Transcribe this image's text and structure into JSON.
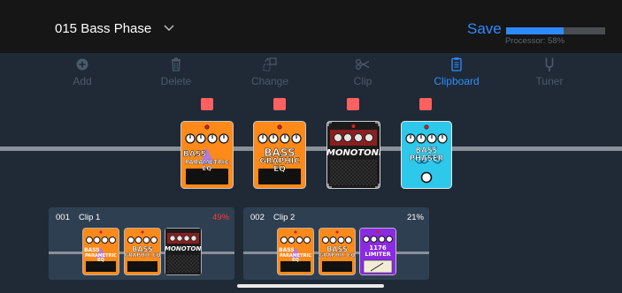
{
  "header": {
    "preset_name": "015 Bass Phase",
    "save_label": "Save",
    "processor_label": "Processor: 58%",
    "processor_fraction": 0.58
  },
  "toolbar": {
    "items": [
      {
        "label": "Add",
        "icon": "plus-circle-icon",
        "active": false
      },
      {
        "label": "Delete",
        "icon": "trash-icon",
        "active": false
      },
      {
        "label": "Change",
        "icon": "change-icon",
        "active": false
      },
      {
        "label": "Clip",
        "icon": "scissors-icon",
        "active": false
      },
      {
        "label": "Clipboard",
        "icon": "clipboard-icon",
        "active": true
      },
      {
        "label": "Tuner",
        "icon": "tuner-fork-icon",
        "active": false
      }
    ]
  },
  "chain": {
    "pedals": [
      {
        "line1": "BASS",
        "line2": "PARAMETRIC EQ",
        "style": "orange-peak"
      },
      {
        "line1": "BASS",
        "line2": "GRAPHIC EQ",
        "style": "orange-graphic"
      },
      {
        "line1": "MONOTONE",
        "line2": "",
        "style": "black-monotone"
      },
      {
        "line1": "BASS PHASER",
        "line2": "",
        "style": "cyan-phaser"
      }
    ],
    "colors": {
      "marker": "#ff6161",
      "orange": "#ff8a1a",
      "cyan": "#2ec8ea",
      "purple": "#8a2be2"
    }
  },
  "clips": [
    {
      "number": "001",
      "name": "Clip 1",
      "percent": "49%",
      "percent_color": "#ff3b30",
      "pedals": [
        {
          "line1": "BASS",
          "line2": "PARAMETRIC EQ"
        },
        {
          "line1": "BASS",
          "line2": "GRAPHIC EQ"
        },
        {
          "line1": "MONOTONE",
          "line2": ""
        }
      ]
    },
    {
      "number": "002",
      "name": "Clip 2",
      "percent": "21%",
      "percent_color": "#ffffff",
      "pedals": [
        {
          "line1": "BASS",
          "line2": "PARAMETRIC EQ"
        },
        {
          "line1": "BASS",
          "line2": "GRAPHIC EQ"
        },
        {
          "line1": "1176",
          "line2": "LIMITER"
        }
      ]
    }
  ]
}
